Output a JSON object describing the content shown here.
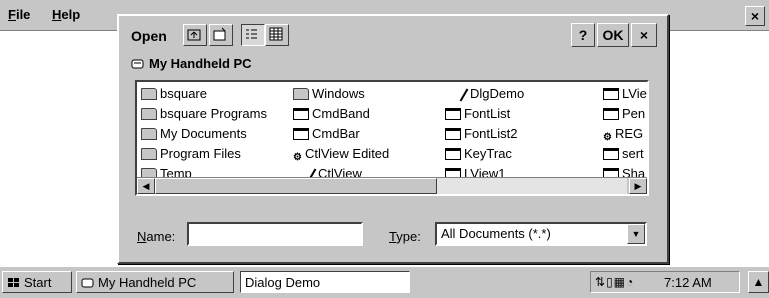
{
  "menubar": {
    "items": [
      {
        "label": "File",
        "accel": "F",
        "rest": "ile"
      },
      {
        "label": "Help",
        "accel": "H",
        "rest": "elp"
      }
    ],
    "close_label": "×"
  },
  "dialog": {
    "title": "Open",
    "help_label": "?",
    "ok_label": "OK",
    "close_label": "×",
    "location": "My Handheld PC",
    "files": [
      {
        "name": "bsquare",
        "icon": "folder-icon"
      },
      {
        "name": "bsquare Programs",
        "icon": "folder-icon"
      },
      {
        "name": "My Documents",
        "icon": "folder-icon"
      },
      {
        "name": "Program Files",
        "icon": "folder-icon"
      },
      {
        "name": "Temp",
        "icon": "folder-icon"
      },
      {
        "name": "Windows",
        "icon": "folder-icon"
      },
      {
        "name": "CmdBand",
        "icon": "app-icon"
      },
      {
        "name": "CmdBar",
        "icon": "app-icon"
      },
      {
        "name": "CtlView Edited",
        "icon": "shortcut-icon"
      },
      {
        "name": "CtlView",
        "icon": "document-icon"
      },
      {
        "name": "DlgDemo",
        "icon": "document-icon"
      },
      {
        "name": "FontList",
        "icon": "app-icon"
      },
      {
        "name": "FontList2",
        "icon": "app-icon"
      },
      {
        "name": "KeyTrac",
        "icon": "app-icon"
      },
      {
        "name": "LView1",
        "icon": "app-icon"
      },
      {
        "name": "LVie",
        "icon": "app-icon"
      },
      {
        "name": "Pen",
        "icon": "app-icon"
      },
      {
        "name": "REG",
        "icon": "registry-icon"
      },
      {
        "name": "sert",
        "icon": "app-icon"
      },
      {
        "name": "Sha",
        "icon": "app-icon"
      }
    ],
    "name_label": {
      "accel": "N",
      "rest": "ame:"
    },
    "name_value": "",
    "type_label": {
      "accel": "T",
      "rest": "ype:"
    },
    "type_value": "All Documents (*.*)"
  },
  "taskbar": {
    "start_label": "Start",
    "tasks": [
      "My Handheld PC",
      "Dialog Demo"
    ],
    "clock": "7:12 AM"
  }
}
